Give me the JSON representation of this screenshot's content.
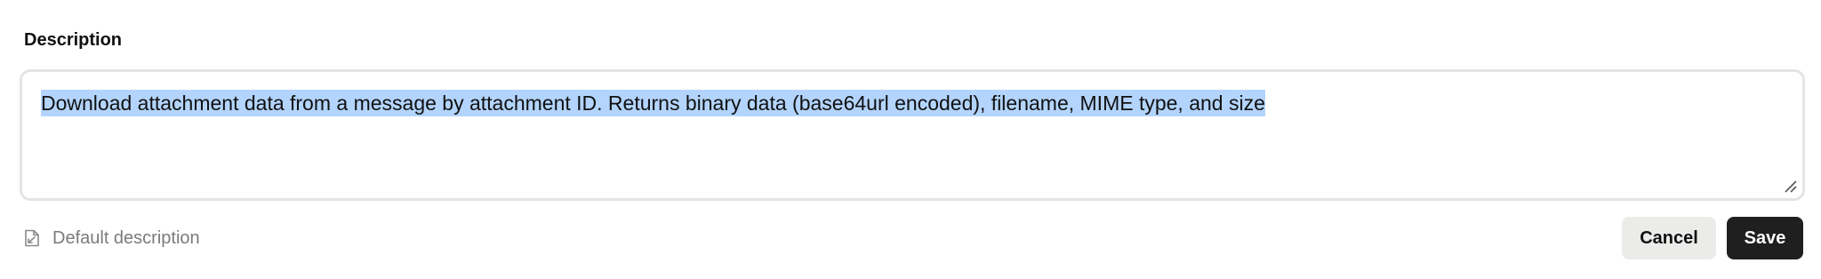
{
  "description": {
    "label": "Description",
    "value": "Download attachment data from a message by attachment ID. Returns binary data (base64url encoded), filename, MIME type, and size"
  },
  "default_description": {
    "label": "Default description",
    "icon": "document-reset-icon"
  },
  "actions": {
    "cancel_label": "Cancel",
    "save_label": "Save"
  },
  "colors": {
    "selection": "#b3d4fc",
    "save_bg": "#1f1f1f",
    "cancel_bg": "#ebebea",
    "muted_text": "#7a7a7a"
  }
}
